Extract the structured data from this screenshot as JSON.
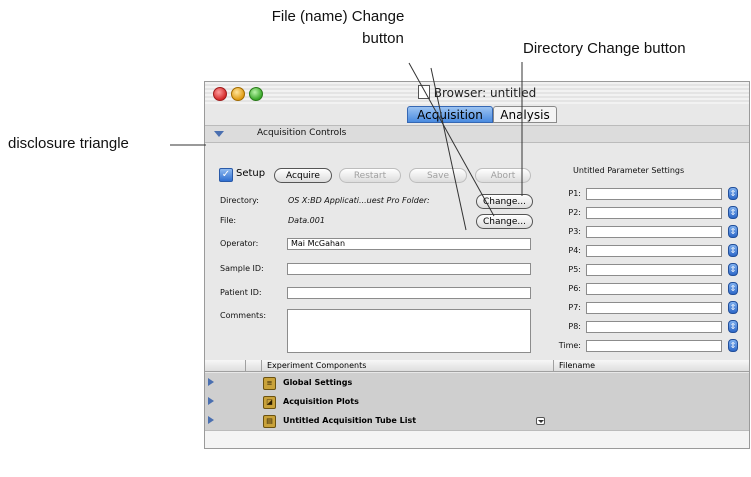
{
  "callouts": {
    "file_change": [
      "File (name) Change",
      "button"
    ],
    "directory_change": "Directory Change button",
    "disclosure": "disclosure triangle"
  },
  "window": {
    "title": "Browser: untitled",
    "tabs": [
      {
        "label": "Acquisition",
        "active": true
      },
      {
        "label": "Analysis",
        "active": false
      }
    ]
  },
  "section": {
    "label": "Acquisition Controls"
  },
  "controls": {
    "setup_label": "Setup",
    "buttons": {
      "acquire": "Acquire",
      "restart": "Restart",
      "save": "Save",
      "abort": "Abort"
    }
  },
  "fields": {
    "directory": {
      "label": "Directory:",
      "value": "OS X:BD Applicati...uest Pro Folder:",
      "button": "Change..."
    },
    "file": {
      "label": "File:",
      "value": "Data.001",
      "button": "Change..."
    },
    "operator": {
      "label": "Operator:",
      "value": "Mai McGahan"
    },
    "sample_id": {
      "label": "Sample ID:",
      "value": ""
    },
    "patient_id": {
      "label": "Patient ID:",
      "value": ""
    },
    "comments": {
      "label": "Comments:",
      "value": ""
    }
  },
  "params": {
    "title": "Untitled Parameter Settings",
    "labels": [
      "P1:",
      "P2:",
      "P3:",
      "P4:",
      "P5:",
      "P6:",
      "P7:",
      "P8:",
      "Time:"
    ]
  },
  "table": {
    "headers": {
      "components": "Experiment Components",
      "filename": "Filename"
    },
    "rows": [
      {
        "name": "Global Settings"
      },
      {
        "name": "Acquisition Plots"
      },
      {
        "name": "Untitled Acquisition Tube List"
      }
    ]
  }
}
